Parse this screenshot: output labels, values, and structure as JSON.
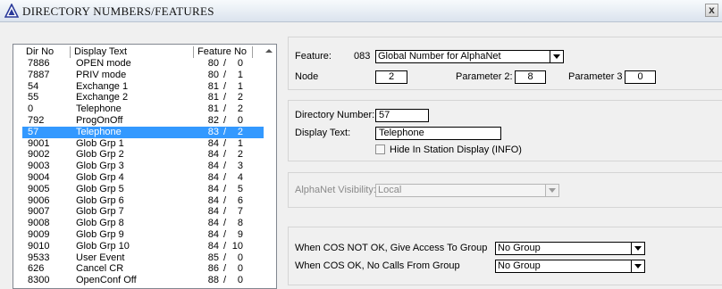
{
  "window": {
    "title": "DIRECTORY NUMBERS/FEATURES",
    "close_label": "x"
  },
  "list": {
    "headers": [
      "Dir No",
      "Display Text",
      "Feature No"
    ],
    "rows": [
      {
        "dir": "7886",
        "text": "OPEN mode",
        "feat": "80",
        "sub": "0"
      },
      {
        "dir": "7887",
        "text": "PRIV mode",
        "feat": "80",
        "sub": "1"
      },
      {
        "dir": "54",
        "text": "Exchange 1",
        "feat": "81",
        "sub": "1"
      },
      {
        "dir": "55",
        "text": "Exchange 2",
        "feat": "81",
        "sub": "2"
      },
      {
        "dir": "0",
        "text": "Telephone",
        "feat": "81",
        "sub": "2"
      },
      {
        "dir": "792",
        "text": "ProgOnOff",
        "feat": "82",
        "sub": "0"
      },
      {
        "dir": "57",
        "text": "Telephone",
        "feat": "83",
        "sub": "2",
        "selected": true
      },
      {
        "dir": "9001",
        "text": "Glob Grp 1",
        "feat": "84",
        "sub": "1"
      },
      {
        "dir": "9002",
        "text": "Glob Grp 2",
        "feat": "84",
        "sub": "2"
      },
      {
        "dir": "9003",
        "text": "Glob Grp 3",
        "feat": "84",
        "sub": "3"
      },
      {
        "dir": "9004",
        "text": "Glob Grp 4",
        "feat": "84",
        "sub": "4"
      },
      {
        "dir": "9005",
        "text": "Glob Grp 5",
        "feat": "84",
        "sub": "5"
      },
      {
        "dir": "9006",
        "text": "Glob Grp 6",
        "feat": "84",
        "sub": "6"
      },
      {
        "dir": "9007",
        "text": "Glob Grp 7",
        "feat": "84",
        "sub": "7"
      },
      {
        "dir": "9008",
        "text": "Glob Grp 8",
        "feat": "84",
        "sub": "8"
      },
      {
        "dir": "9009",
        "text": "Glob Grp 9",
        "feat": "84",
        "sub": "9"
      },
      {
        "dir": "9010",
        "text": "Glob Grp 10",
        "feat": "84",
        "sub": "10"
      },
      {
        "dir": "9533",
        "text": "User Event",
        "feat": "85",
        "sub": "0"
      },
      {
        "dir": "626",
        "text": "Cancel CR",
        "feat": "86",
        "sub": "0"
      },
      {
        "dir": "8300",
        "text": "OpenConf Off",
        "feat": "88",
        "sub": "0"
      }
    ]
  },
  "feature": {
    "label": "Feature:",
    "code": "083",
    "value": "Global Number for AlphaNet",
    "node_label": "Node",
    "node_value": "2",
    "param2_label": "Parameter 2:",
    "param2_value": "8",
    "param3_label": "Parameter 3",
    "param3_value": "0"
  },
  "directory": {
    "number_label": "Directory Number:",
    "number_value": "57",
    "text_label": "Display Text:",
    "text_value": "Telephone",
    "hide_label": "Hide In Station Display (INFO)"
  },
  "alphanet": {
    "label": "AlphaNet Visibility:",
    "value": "Local"
  },
  "cos": {
    "not_ok_label": "When COS NOT OK, Give Access To Group",
    "not_ok_value": "No Group",
    "ok_label": "When COS OK, No Calls From Group",
    "ok_value": "No Group"
  },
  "separator": "/",
  "colors": {
    "selection": "#3399ff",
    "window_bg": "#f0f0f0"
  }
}
